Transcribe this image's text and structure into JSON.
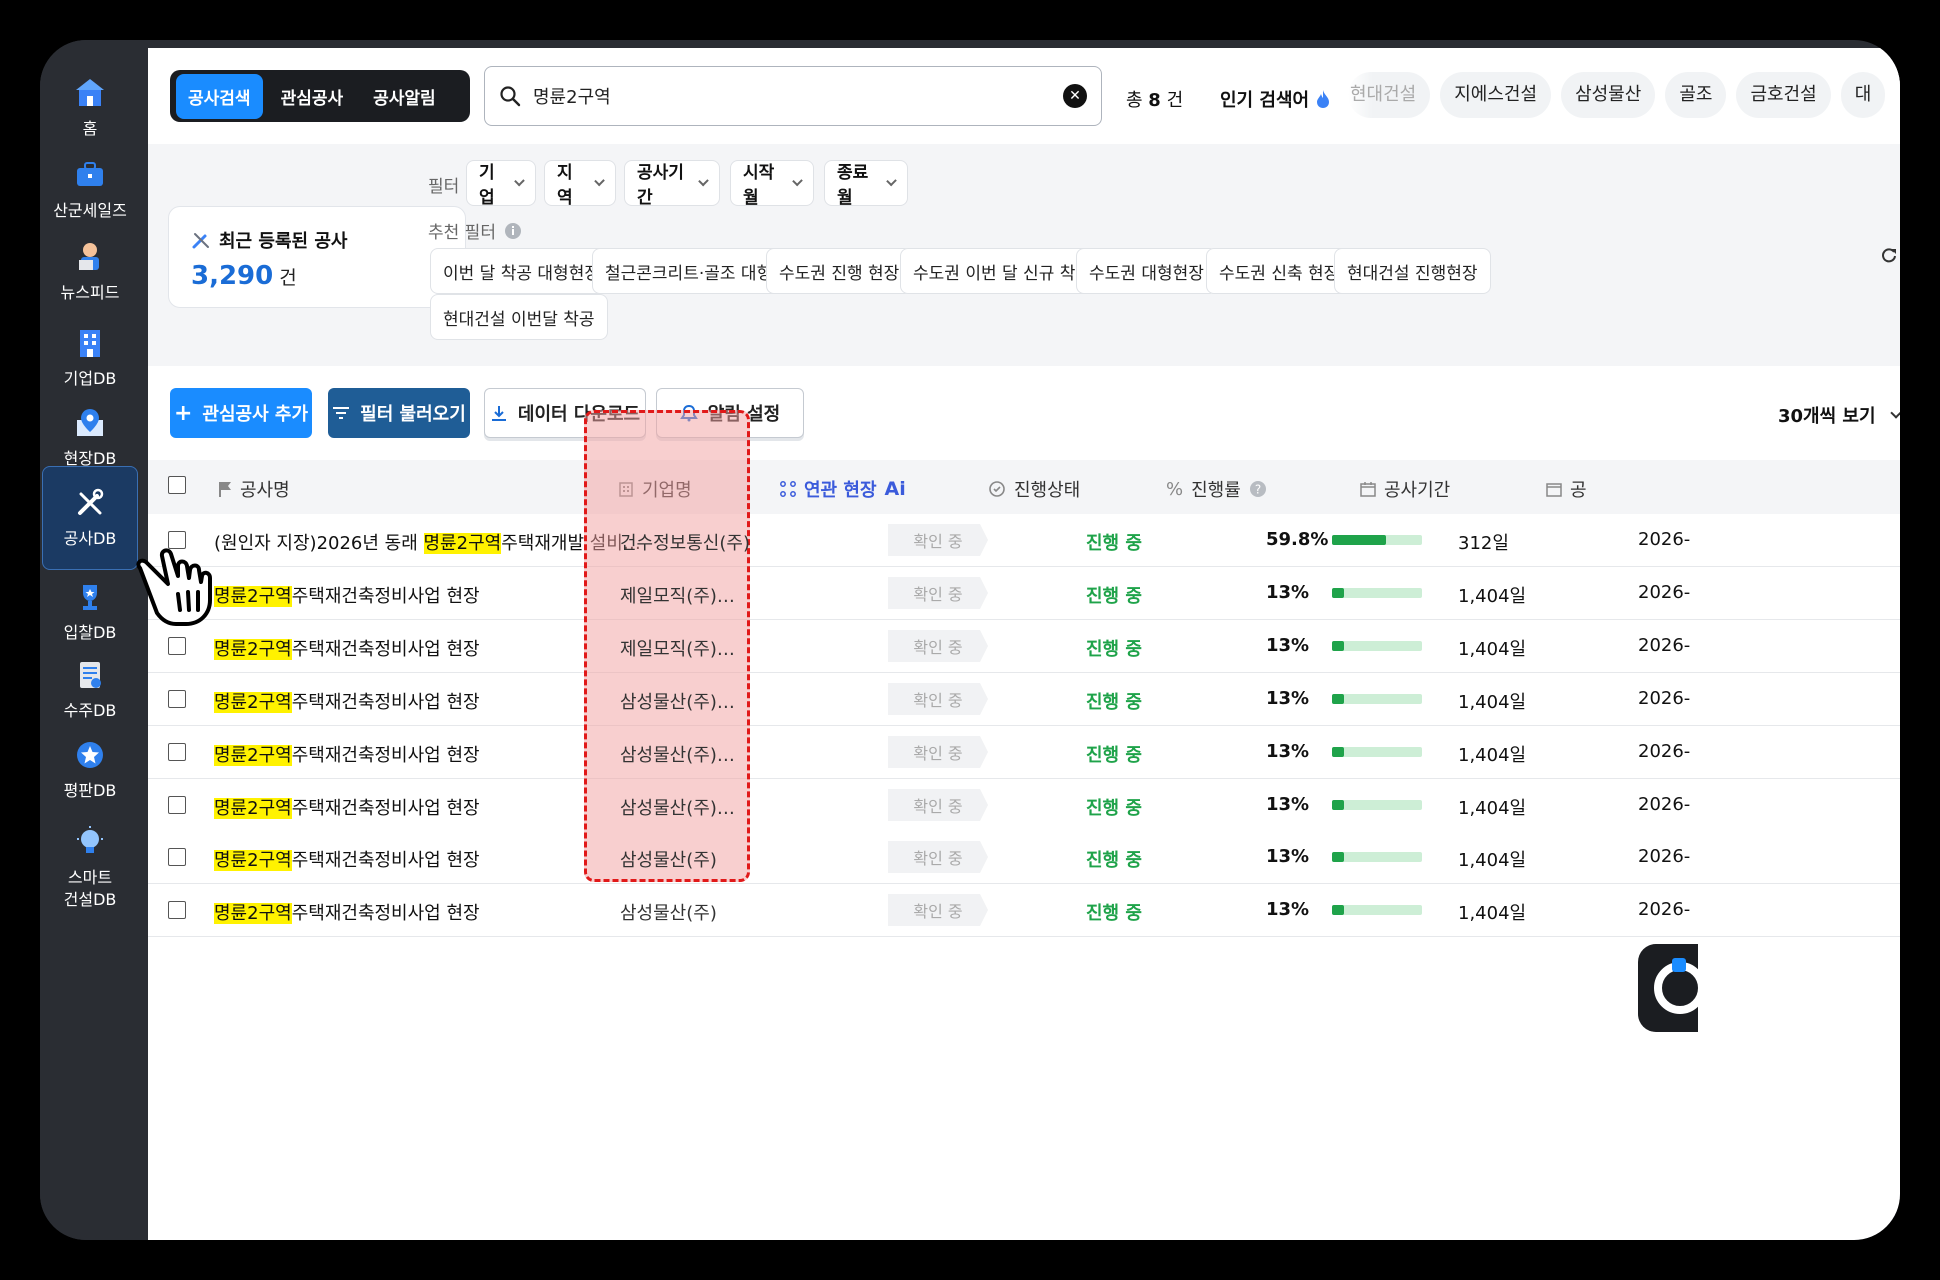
{
  "sidebar": {
    "items": [
      {
        "label": "홈",
        "icon": "home-icon"
      },
      {
        "label": "산군세일즈",
        "icon": "briefcase-icon"
      },
      {
        "label": "뉴스피드",
        "icon": "news-reader-icon"
      },
      {
        "label": "기업DB",
        "icon": "building-icon"
      },
      {
        "label": "현장DB",
        "icon": "map-pin-icon"
      },
      {
        "label": "공사DB",
        "icon": "tools-icon"
      },
      {
        "label": "입찰DB",
        "icon": "trophy-icon"
      },
      {
        "label": "수주DB",
        "icon": "document-icon"
      },
      {
        "label": "평판DB",
        "icon": "star-badge-icon"
      },
      {
        "label": "스마트\n건설DB",
        "icon": "lightbulb-icon"
      }
    ],
    "active_index": 5
  },
  "topbar": {
    "tabs": [
      "공사검색",
      "관심공사",
      "공사알림"
    ],
    "search_value": "명륜2구역",
    "total_prefix": "총",
    "total_count": "8",
    "total_unit": "건",
    "popular_label": "인기 검색어",
    "popular_keywords": [
      "현대건설",
      "지에스건설",
      "삼성물산",
      "골조",
      "금호건설",
      "대"
    ]
  },
  "filters": {
    "label": "필터",
    "dropdowns": [
      "기업",
      "지역",
      "공사기간",
      "시작월",
      "종료월"
    ],
    "recommended_label": "추천 필터",
    "recommended": [
      "이번 달 착공 대형현장",
      "철근콘크리트·골조 대형",
      "수도권 진행 현장",
      "수도권 이번 달 신규 착공",
      "수도권 대형현장",
      "수도권 신축 현장",
      "현대건설 진행현장",
      "현대건설 이번달 착공"
    ]
  },
  "recent": {
    "title": "최근 등록된 공사",
    "count": "3,290",
    "unit": "건",
    "arrow": "»"
  },
  "actions": {
    "add_interest": "관심공사 추가",
    "load_filter": "필터 불러오기",
    "download": "데이터 다운로드",
    "alert": "알림 설정",
    "per_page": "30개씩 보기"
  },
  "table": {
    "columns": [
      "공사명",
      "기업명",
      "연관 현장",
      "진행상태",
      "진행률",
      "공사기간",
      "공"
    ],
    "ai_badge": "Ai",
    "rows": [
      {
        "name_pre": "(원인자 지장)2026년 동래 ",
        "name_hl": "명륜2구역",
        "name_post": "주택재개발 설비…",
        "company": "건수정보통신(주)",
        "related": "확인 중",
        "status": "진행 중",
        "progress": "59.8%",
        "progress_value": 59.8,
        "days": "312일",
        "date": "2026-"
      },
      {
        "name_pre": "",
        "name_hl": "명륜2구역",
        "name_post": "주택재건축정비사업 현장",
        "company": "제일모직(주)…",
        "related": "확인 중",
        "status": "진행 중",
        "progress": "13%",
        "progress_value": 13,
        "days": "1,404일",
        "date": "2026-"
      },
      {
        "name_pre": "",
        "name_hl": "명륜2구역",
        "name_post": "주택재건축정비사업 현장",
        "company": "제일모직(주)…",
        "related": "확인 중",
        "status": "진행 중",
        "progress": "13%",
        "progress_value": 13,
        "days": "1,404일",
        "date": "2026-"
      },
      {
        "name_pre": "",
        "name_hl": "명륜2구역",
        "name_post": "주택재건축정비사업 현장",
        "company": "삼성물산(주)…",
        "related": "확인 중",
        "status": "진행 중",
        "progress": "13%",
        "progress_value": 13,
        "days": "1,404일",
        "date": "2026-"
      },
      {
        "name_pre": "",
        "name_hl": "명륜2구역",
        "name_post": "주택재건축정비사업 현장",
        "company": "삼성물산(주)…",
        "related": "확인 중",
        "status": "진행 중",
        "progress": "13%",
        "progress_value": 13,
        "days": "1,404일",
        "date": "2026-"
      },
      {
        "name_pre": "",
        "name_hl": "명륜2구역",
        "name_post": "주택재건축정비사업 현장",
        "company": "삼성물산(주)…",
        "related": "확인 중",
        "status": "진행 중",
        "progress": "13%",
        "progress_value": 13,
        "days": "1,404일",
        "date": "2026-"
      },
      {
        "name_pre": "",
        "name_hl": "명륜2구역",
        "name_post": "주택재건축정비사업 현장",
        "company": "삼성물산(주)",
        "related": "확인 중",
        "status": "진행 중",
        "progress": "13%",
        "progress_value": 13,
        "days": "1,404일",
        "date": "2026-"
      },
      {
        "name_pre": "",
        "name_hl": "명륜2구역",
        "name_post": "주택재건축정비사업 현장",
        "company": "삼성물산(주)",
        "related": "확인 중",
        "status": "진행 중",
        "progress": "13%",
        "progress_value": 13,
        "days": "1,404일",
        "date": "2026-"
      }
    ]
  },
  "colors": {
    "accent": "#1a8cff",
    "status_green": "#1fa34a",
    "highlight": "#fff200",
    "annotation_red": "#e11919"
  }
}
